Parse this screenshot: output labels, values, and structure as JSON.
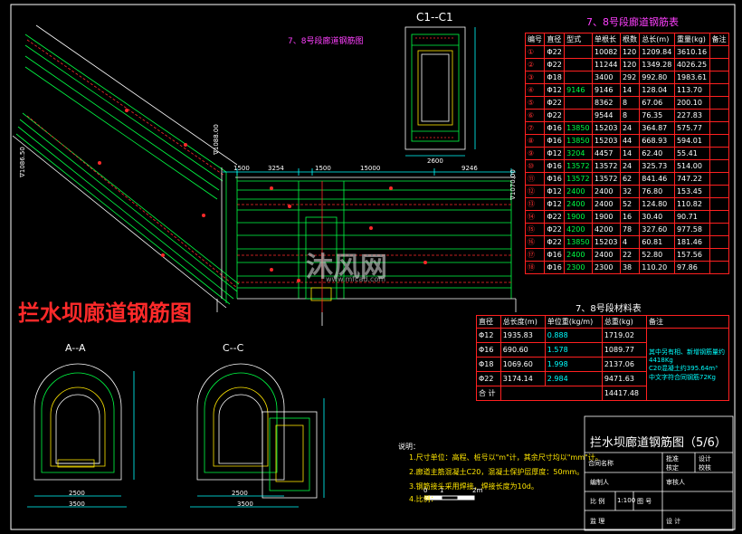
{
  "drawing": {
    "main_title": "拦水坝廊道钢筋图",
    "sheet_title": "拦水坝廊道钢筋图（5/6）",
    "watermark": "沐风网",
    "watermark_url": "www.mfcad.com"
  },
  "views": {
    "plan_title": "7、8号段廊道钢筋图",
    "section_c1": "C1--C1",
    "section_a": "A--A",
    "section_c": "C--C",
    "dims_top": [
      "1500",
      "3254",
      "1500",
      "15000",
      "9246"
    ],
    "left_elev": "∇1086.50",
    "mid_elev": "∇1088.00",
    "right_elev": "∇1070.00",
    "c1_dims": [
      "2600"
    ],
    "a_dims": [
      "2500",
      "3500"
    ],
    "c_dims": [
      "2500",
      "3500"
    ]
  },
  "rebar_table": {
    "title": "7、8号段廊道钢筋表",
    "headers": [
      "编号",
      "直径",
      "型式",
      "单根长",
      "根数",
      "总长(m)",
      "重量(kg)",
      "备注"
    ],
    "rows": [
      [
        "①",
        "Φ22",
        "",
        "10082",
        "120",
        "1209.84",
        "3610.16"
      ],
      [
        "②",
        "Φ22",
        "",
        "11244",
        "120",
        "1349.28",
        "4026.25"
      ],
      [
        "③",
        "Φ18",
        "",
        "3400",
        "292",
        "992.80",
        "1983.61"
      ],
      [
        "④",
        "Φ12",
        "9146",
        "9146",
        "14",
        "128.04",
        "113.70"
      ],
      [
        "⑤",
        "Φ22",
        "",
        "8362",
        "8",
        "67.06",
        "200.10"
      ],
      [
        "⑥",
        "Φ22",
        "",
        "9544",
        "8",
        "76.35",
        "227.83"
      ],
      [
        "⑦",
        "Φ16",
        "13850",
        "15203",
        "24",
        "364.87",
        "575.77"
      ],
      [
        "⑧",
        "Φ16",
        "13850",
        "15203",
        "44",
        "668.93",
        "594.01"
      ],
      [
        "⑨",
        "Φ12",
        "3204",
        "4457",
        "14",
        "62.40",
        "55.41"
      ],
      [
        "⑩",
        "Φ16",
        "13572",
        "13572",
        "24",
        "325.73",
        "514.00"
      ],
      [
        "⑪",
        "Φ16",
        "13572",
        "13572",
        "62",
        "841.46",
        "747.22"
      ],
      [
        "⑫",
        "Φ12",
        "2400",
        "2400",
        "32",
        "76.80",
        "153.45"
      ],
      [
        "⑬",
        "Φ12",
        "2400",
        "2400",
        "52",
        "124.80",
        "110.82"
      ],
      [
        "⑭",
        "Φ22",
        "1900",
        "1900",
        "16",
        "30.40",
        "90.71"
      ],
      [
        "⑮",
        "Φ22",
        "4200",
        "4200",
        "78",
        "327.60",
        "977.58"
      ],
      [
        "⑯",
        "Φ22",
        "13850",
        "15203",
        "4",
        "60.81",
        "181.46"
      ],
      [
        "⑰",
        "Φ16",
        "2400",
        "2400",
        "22",
        "52.80",
        "157.56"
      ],
      [
        "⑱",
        "Φ16",
        "2300",
        "2300",
        "38",
        "110.20",
        "97.86"
      ]
    ]
  },
  "material_table": {
    "title": "7、8号段材料表",
    "headers": [
      "直径",
      "总长度(m)",
      "单位重(kg/m)",
      "总重(kg)",
      "备注"
    ],
    "rows": [
      [
        "Φ12",
        "1935.83",
        "0.888",
        "1719.02"
      ],
      [
        "Φ16",
        "690.60",
        "1.578",
        "1089.77"
      ],
      [
        "Φ18",
        "1069.60",
        "1.998",
        "2137.06"
      ],
      [
        "Φ22",
        "3174.14",
        "2.984",
        "9471.63"
      ]
    ],
    "total_label": "合 计",
    "total_value": "14417.48",
    "remarks": [
      "其中另有相、新增钢筋量约4418Kg",
      "C20混凝土约395.64m³",
      "中文字符合同钢筋72Kg"
    ]
  },
  "notes": {
    "title": "说明：",
    "lines": [
      "1.尺寸单位：高程、桩号以\"m\"计，其余尺寸均以\"mm\"计。",
      "2.廊道主筋混凝土C20，混凝土保护层厚度：50mm。",
      "3.钢筋接头采用焊接，焊接长度为10d。",
      "4.比例："
    ],
    "scale_marks": [
      "0",
      "1",
      "2m"
    ]
  },
  "title_block": {
    "r1a": "合同名称",
    "r1b": "批准",
    "r1c": "设计",
    "r1d": "核定",
    "r1e": "校核",
    "r2a": "编制人",
    "r2b": "审核人",
    "r3a": "比 例",
    "r3b": "1:100",
    "r3c": "图 号",
    "r4a": "监 理",
    "r4b": "设 计"
  }
}
